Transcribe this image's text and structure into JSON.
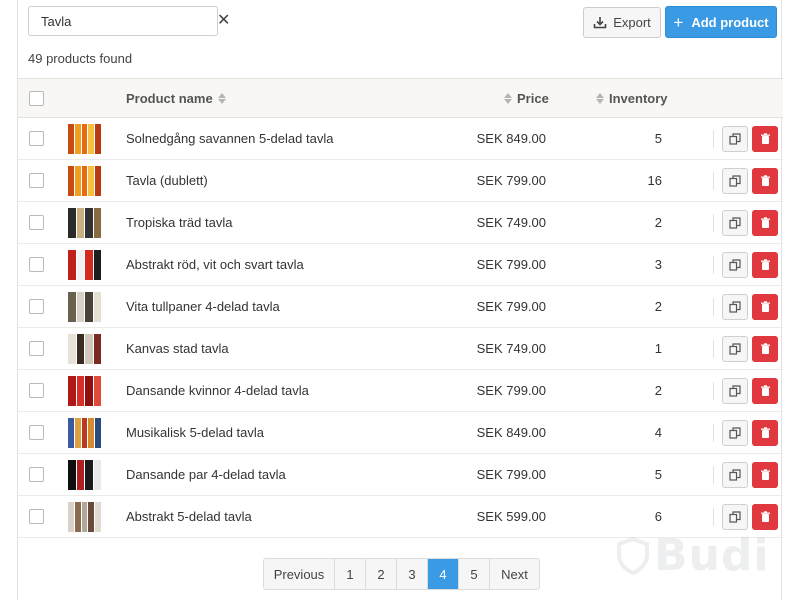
{
  "search": {
    "value": "Tavla",
    "clear_glyph": "✕"
  },
  "toolbar": {
    "export_label": "Export",
    "add_label": "Add product",
    "add_glyph": "+"
  },
  "count_text": "49 products found",
  "table": {
    "headers": {
      "name": "Product name",
      "price": "Price",
      "inventory": "Inventory"
    },
    "rows": [
      {
        "name": "Solnedgång savannen 5-delad tavla",
        "price": "SEK 849.00",
        "inventory": "5",
        "thumb": [
          "#c94a12",
          "#f0a020",
          "#e86a10",
          "#f5c040",
          "#b83a10"
        ]
      },
      {
        "name": "Tavla (dublett)",
        "price": "SEK 799.00",
        "inventory": "16",
        "thumb": [
          "#c94a12",
          "#f0a020",
          "#e86a10",
          "#f5c040",
          "#b83a10"
        ]
      },
      {
        "name": "Tropiska träd tavla",
        "price": "SEK 749.00",
        "inventory": "2",
        "thumb": [
          "#2a2a2a",
          "#c8b080",
          "#333333",
          "#8a6a40"
        ]
      },
      {
        "name": "Abstrakt röd, vit och svart tavla",
        "price": "SEK 799.00",
        "inventory": "3",
        "thumb": [
          "#c0201a",
          "#f2f2f2",
          "#d42a20",
          "#1e1e1e"
        ]
      },
      {
        "name": "Vita tullpaner 4-delad tavla",
        "price": "SEK 799.00",
        "inventory": "2",
        "thumb": [
          "#6a6050",
          "#d8d2c4",
          "#4a4238",
          "#e4dfd2"
        ]
      },
      {
        "name": "Kanvas stad tavla",
        "price": "SEK 749.00",
        "inventory": "1",
        "thumb": [
          "#e6e2d8",
          "#3a2a22",
          "#d0c8b8",
          "#7a2a20"
        ]
      },
      {
        "name": "Dansande kvinnor 4-delad tavla",
        "price": "SEK 799.00",
        "inventory": "2",
        "thumb": [
          "#b01818",
          "#d83028",
          "#901010",
          "#e04a3a"
        ]
      },
      {
        "name": "Musikalisk 5-delad tavla",
        "price": "SEK 849.00",
        "inventory": "4",
        "thumb": [
          "#3a5aa0",
          "#e0a040",
          "#b83a20",
          "#d88a30",
          "#2a4a80"
        ]
      },
      {
        "name": "Dansande par 4-delad tavla",
        "price": "SEK 799.00",
        "inventory": "5",
        "thumb": [
          "#101010",
          "#b02020",
          "#1a1a1a",
          "#e8e8e8"
        ]
      },
      {
        "name": "Abstrakt 5-delad tavla",
        "price": "SEK 599.00",
        "inventory": "6",
        "thumb": [
          "#d8d2c8",
          "#8a6a50",
          "#b0a898",
          "#6a4a38",
          "#e0dad0"
        ]
      }
    ]
  },
  "pagination": {
    "prev_label": "Previous",
    "pages": [
      "1",
      "2",
      "3",
      "4",
      "5"
    ],
    "active_page": "4",
    "next_label": "Next"
  },
  "watermark": "Budi",
  "colors": {
    "accent": "#3a9ae3",
    "danger": "#e0383e"
  }
}
